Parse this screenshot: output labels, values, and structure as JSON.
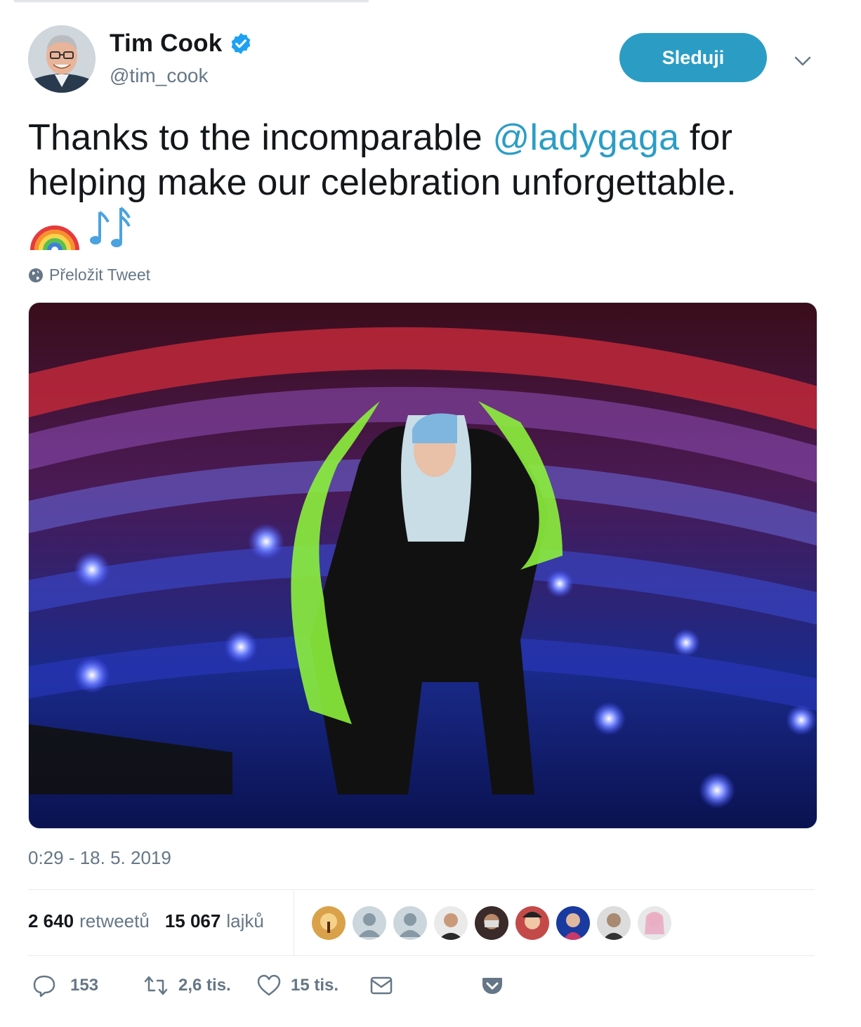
{
  "author": {
    "display_name": "Tim Cook",
    "handle": "@tim_cook",
    "verified": true
  },
  "follow_button": {
    "label": "Sleduji"
  },
  "tweet": {
    "text_before": "Thanks to the incomparable ",
    "mention": "@ladygaga",
    "text_after": " for helping make our celebration unforgettable.",
    "emojis": [
      "rainbow",
      "musical-notes"
    ],
    "translate_label": "Přeložit Tweet",
    "timestamp": "0:29 - 18. 5. 2019"
  },
  "stats": {
    "retweets_count": "2 640",
    "retweets_label": "retweetů",
    "likes_count": "15 067",
    "likes_label": "lajků"
  },
  "likers": [
    "liker-1",
    "liker-2",
    "liker-3",
    "liker-4",
    "liker-5",
    "liker-6",
    "liker-7",
    "liker-8",
    "liker-9"
  ],
  "actions": {
    "replies": "153",
    "retweets": "2,6 tis.",
    "likes": "15 tis."
  },
  "colors": {
    "accent": "#2b9dc5",
    "secondary_text": "#657786",
    "verified": "#1da1f2"
  }
}
